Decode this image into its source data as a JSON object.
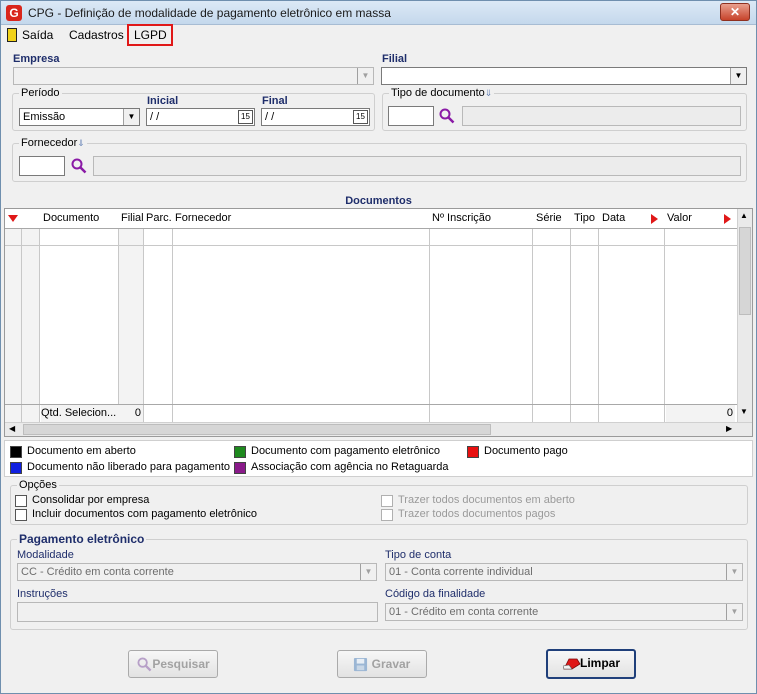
{
  "window": {
    "title": "CPG - Definição de modalidade de pagamento eletrônico em massa",
    "logo_letter": "G",
    "close_symbol": "✕"
  },
  "menu": {
    "items": [
      "Saída",
      "Cadastros",
      "LGPD"
    ]
  },
  "empresa": {
    "label": "Empresa",
    "value": ""
  },
  "filial": {
    "label": "Filial",
    "value": ""
  },
  "periodo": {
    "group_label": "Período",
    "type_value": "Emissão",
    "inicial_label": "Inicial",
    "inicial_value": " / /",
    "final_label": "Final",
    "final_value": " / /",
    "calendar_glyph": "15"
  },
  "tipo_documento": {
    "group_label": "Tipo de documento",
    "code": "",
    "description": ""
  },
  "fornecedor": {
    "group_label": "Fornecedor",
    "code": "",
    "description": ""
  },
  "documentos": {
    "title": "Documentos",
    "columns": [
      "Documento",
      "Filial",
      "Parc.",
      "Fornecedor",
      "Nº Inscrição",
      "Série",
      "Tipo",
      "Data",
      "Valor"
    ],
    "footer": {
      "count_label": "Qtd. Selecion...",
      "count_value": "0",
      "total_value": "0"
    }
  },
  "legend": [
    {
      "label": "Documento em aberto",
      "color": "#000000"
    },
    {
      "label": "Documento com pagamento eletrônico",
      "color": "#1e8a1e"
    },
    {
      "label": "Documento pago",
      "color": "#e81010"
    },
    {
      "label": "Documento não liberado para pagamento",
      "color": "#1020e0"
    },
    {
      "label": "Associação com agência no Retaguarda",
      "color": "#8a1a8a"
    }
  ],
  "opcoes": {
    "group_label": "Opções",
    "items": [
      {
        "label": "Consolidar por empresa",
        "checked": false,
        "enabled": true
      },
      {
        "label": "Incluir documentos com pagamento eletrônico",
        "checked": false,
        "enabled": true
      },
      {
        "label": "Trazer todos documentos em aberto",
        "checked": false,
        "enabled": false
      },
      {
        "label": "Trazer todos documentos pagos",
        "checked": false,
        "enabled": false
      }
    ]
  },
  "pagamento": {
    "group_label": "Pagamento eletrônico",
    "modalidade_label": "Modalidade",
    "modalidade_value": "CC   - Crédito em conta corrente",
    "tipo_conta_label": "Tipo de conta",
    "tipo_conta_value": "01 - Conta corrente individual",
    "instrucoes_label": "Instruções",
    "instrucoes_value": "",
    "finalidade_label": "Código da finalidade",
    "finalidade_value": "01 - Crédito em conta corrente"
  },
  "buttons": {
    "pesquisar": "Pesquisar",
    "gravar": "Gravar",
    "limpar": "Limpar"
  }
}
